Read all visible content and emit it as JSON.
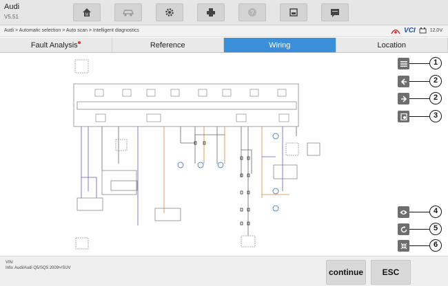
{
  "app": {
    "title": "Audi",
    "version": "V5.51"
  },
  "toolbar": {
    "icons": [
      "home-icon",
      "vehicle-icon",
      "settings-icon",
      "print-icon",
      "help-icon",
      "save-icon",
      "message-icon"
    ]
  },
  "breadcrumb": "Audi > Automatic selection > Auto scan > Intelligent diagnostics",
  "status": {
    "vci_label": "VCI",
    "voltage": "12.0V"
  },
  "tabs": [
    {
      "label": "Fault Analysis",
      "active": false,
      "has_alert": true
    },
    {
      "label": "Reference",
      "active": false
    },
    {
      "label": "Wiring",
      "active": true
    },
    {
      "label": "Location",
      "active": false
    }
  ],
  "side_tools": [
    {
      "icon": "list-icon",
      "callout": "1"
    },
    {
      "icon": "arrow-left-icon",
      "callout": "2"
    },
    {
      "icon": "arrow-right-icon",
      "callout": "2"
    },
    {
      "icon": "report-icon",
      "callout": "3"
    },
    {
      "icon": "eye-icon",
      "callout": "4"
    },
    {
      "icon": "refresh-icon",
      "callout": "5"
    },
    {
      "icon": "collapse-icon",
      "callout": "6"
    }
  ],
  "footer": {
    "vin": "VIN:",
    "info": "Info: Audi/Audi Q5/SQ5 2009>/SUV",
    "continue_label": "continue",
    "esc_label": "ESC"
  },
  "colors": {
    "accent": "#3b8fd8",
    "alert": "#e53935",
    "tool_button": "#6e6e6e"
  }
}
